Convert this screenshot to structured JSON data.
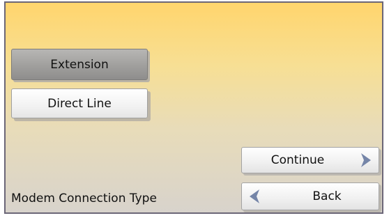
{
  "options": [
    {
      "label": "Extension",
      "selected": true
    },
    {
      "label": "Direct Line",
      "selected": false
    }
  ],
  "navigation": {
    "continue_label": "Continue",
    "back_label": "Back",
    "continue_icon": "chevron-right-icon",
    "back_icon": "chevron-left-icon"
  },
  "screen_title": "Modem Connection Type",
  "colors": {
    "background_top": "#ffd56d",
    "background_bottom": "#d8d3cc",
    "selected_option": "#a09f9d",
    "chevron": "#7585a8",
    "frame_border": "#6b6677"
  }
}
